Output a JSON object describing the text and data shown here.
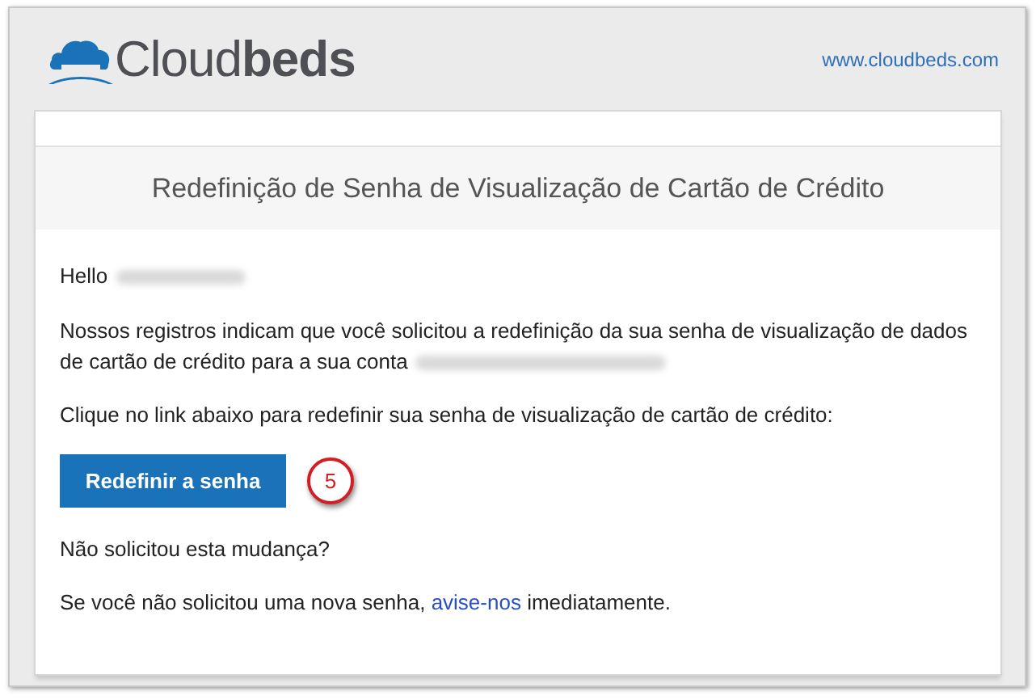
{
  "header": {
    "logo": {
      "light": "Cloud",
      "bold": "beds"
    },
    "link": "www.cloudbeds.com"
  },
  "email": {
    "title": "Redefinição de Senha de Visualização de Cartão de Crédito",
    "greeting": "Hello",
    "intro": "Nossos registros indicam que você solicitou a redefinição da sua senha de visualização de dados de cartão de crédito para a sua conta",
    "instruction": "Clique no link abaixo para redefinir sua senha de visualização de cartão de crédito:",
    "button": "Redefinir a senha",
    "step_badge": "5",
    "question": "Não solicitou esta mudança?",
    "notice": {
      "before": "Se você não solicitou uma nova senha,",
      "link": "avise-nos",
      "after": "imediatamente."
    }
  }
}
